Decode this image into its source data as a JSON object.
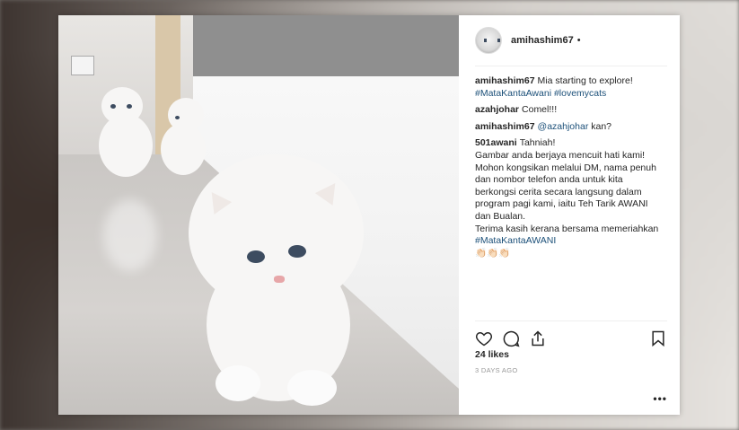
{
  "post": {
    "username": "amihashim67",
    "header_dot": "•"
  },
  "comments": [
    {
      "user": "amihashim67",
      "text": "Mia starting to explore!",
      "tags": "#MataKantaAwani #lovemycats"
    },
    {
      "user": "azahjohar",
      "text": "Comel!!!"
    },
    {
      "user": "amihashim67",
      "mention": "@azahjohar",
      "text": "kan?"
    },
    {
      "user": "501awani",
      "text": "Tahniah!",
      "lines": [
        "Gambar anda berjaya mencuit hati kami!",
        "Mohon kongsikan melalui DM, nama penuh",
        "dan nombor telefon anda untuk kita",
        "berkongsi cerita secara langsung dalam",
        "program pagi kami, iaitu Teh Tarik AWANI",
        "dan Bualan.",
        "Terima kasih kerana bersama memeriahkan"
      ],
      "tag": "#MataKantaAWANI",
      "emoji": "👏🏻👏🏻👏🏻"
    }
  ],
  "actions": {
    "like_icon": "heart-icon",
    "comment_icon": "comment-icon",
    "share_icon": "share-icon",
    "save_icon": "bookmark-icon"
  },
  "likes": "24 likes",
  "timestamp": "3 DAYS AGO",
  "more": "•••"
}
